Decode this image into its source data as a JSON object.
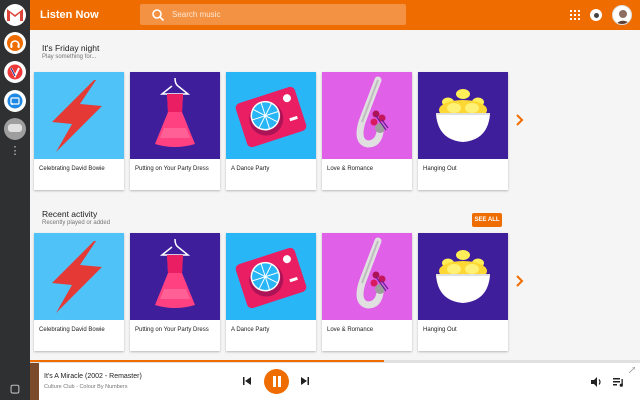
{
  "app": {
    "title": "Listen Now",
    "accent": "#ef6c00"
  },
  "search": {
    "placeholder": "Search music",
    "value": ""
  },
  "launcher": {
    "items": [
      "gmail-icon",
      "play-music-icon",
      "vivaldi-icon",
      "cast-icon",
      "chat-icon",
      "more-icon"
    ]
  },
  "sections": [
    {
      "title": "It's Friday night",
      "subtitle": "Play something for...",
      "see_all": "",
      "cards": [
        {
          "label": "Celebrating David Bowie",
          "bg": "#4fc3f7",
          "art": "lightning-bolt"
        },
        {
          "label": "Putting on Your Party Dress",
          "bg": "#3f1e9c",
          "art": "party-dress"
        },
        {
          "label": "A Dance Party",
          "bg": "#29b6f6",
          "art": "turntable"
        },
        {
          "label": "Love & Romance",
          "bg": "#e060e8",
          "art": "saxophone-roses"
        },
        {
          "label": "Hanging Out",
          "bg": "#3f1e9c",
          "art": "chips-bowl"
        }
      ]
    },
    {
      "title": "Recent activity",
      "subtitle": "Recently played or added",
      "see_all": "SEE ALL",
      "cards": [
        {
          "label": "Celebrating David Bowie",
          "bg": "#4fc3f7",
          "art": "lightning-bolt"
        },
        {
          "label": "Putting on Your Party Dress",
          "bg": "#3f1e9c",
          "art": "party-dress"
        },
        {
          "label": "A Dance Party",
          "bg": "#29b6f6",
          "art": "turntable"
        },
        {
          "label": "Love & Romance",
          "bg": "#e060e8",
          "art": "saxophone-roses"
        },
        {
          "label": "Hanging Out",
          "bg": "#3f1e9c",
          "art": "chips-bowl"
        }
      ]
    }
  ],
  "player": {
    "song": "It's A Miracle (2002 - Remaster)",
    "artist": "Culture Club - Colour By Numbers",
    "progress": 0.58,
    "state": "playing"
  }
}
